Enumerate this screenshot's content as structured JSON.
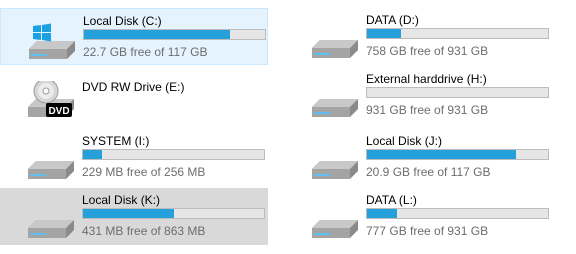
{
  "colors": {
    "bar_fill": "#26a0da",
    "bar_track": "#e6e6e6",
    "selected_bg": "#e5f3ff",
    "hover_bg": "#d9d9d9"
  },
  "drives": [
    {
      "name": "Local Disk (C:)",
      "info": "22.7 GB free of 117 GB",
      "used_fraction": 0.806,
      "icon": "windows-drive-icon",
      "state": "selected"
    },
    {
      "name": "DATA (D:)",
      "info": "758 GB free of 931 GB",
      "used_fraction": 0.186,
      "icon": "hard-drive-icon",
      "state": "normal"
    },
    {
      "name": "DVD RW Drive (E:)",
      "info": "",
      "icon": "dvd-drive-icon",
      "dvd_label": "DVD",
      "state": "normal"
    },
    {
      "name": "External harddrive (H:)",
      "info": "931 GB free of 931 GB",
      "used_fraction": 0.0,
      "icon": "hard-drive-icon",
      "state": "normal"
    },
    {
      "name": "SYSTEM (I:)",
      "info": "229 MB free of 256 MB",
      "used_fraction": 0.105,
      "icon": "hard-drive-icon",
      "state": "normal"
    },
    {
      "name": "Local Disk (J:)",
      "info": "20.9 GB free of 117 GB",
      "used_fraction": 0.821,
      "icon": "hard-drive-icon",
      "state": "normal"
    },
    {
      "name": "Local Disk (K:)",
      "info": "431 MB free of 863 MB",
      "used_fraction": 0.5,
      "icon": "hard-drive-icon",
      "state": "hover"
    },
    {
      "name": "DATA (L:)",
      "info": "777 GB free of 931 GB",
      "used_fraction": 0.165,
      "icon": "hard-drive-icon",
      "state": "normal"
    }
  ]
}
